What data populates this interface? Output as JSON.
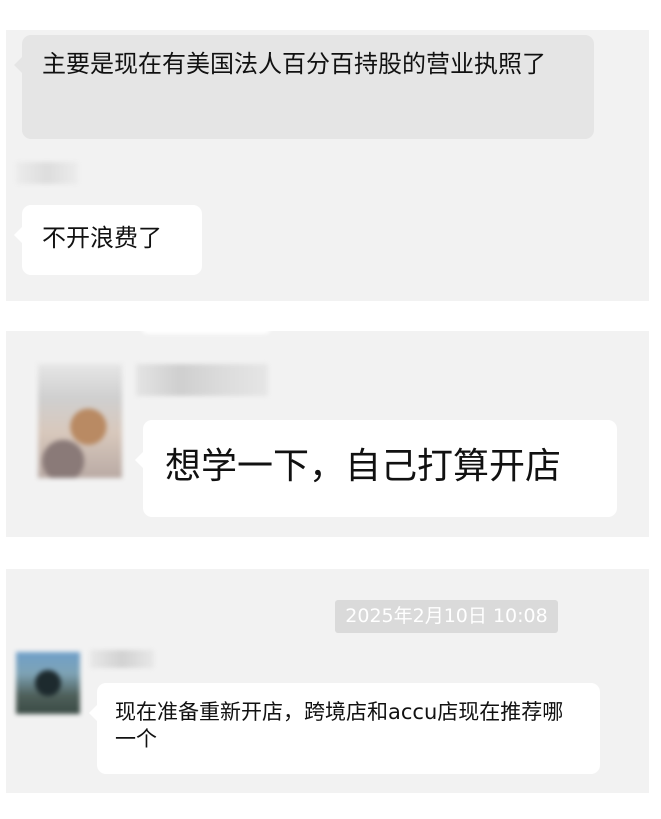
{
  "messages": [
    {
      "text": "主要是现在有美国法人百分百持股的营业执照了"
    },
    {
      "text": "不开浪费了"
    },
    {
      "text": "想学一下，自己打算开店"
    },
    {
      "text": "现在准备重新开店，跨境店和accu店现在推荐哪一个"
    }
  ],
  "timestamp": "2025年2月10日 10:08",
  "colors": {
    "panel_bg": "#f2f2f2",
    "bubble_gray": "#e5e5e5",
    "bubble_white": "#ffffff",
    "timestamp_bg": "#dadada"
  }
}
